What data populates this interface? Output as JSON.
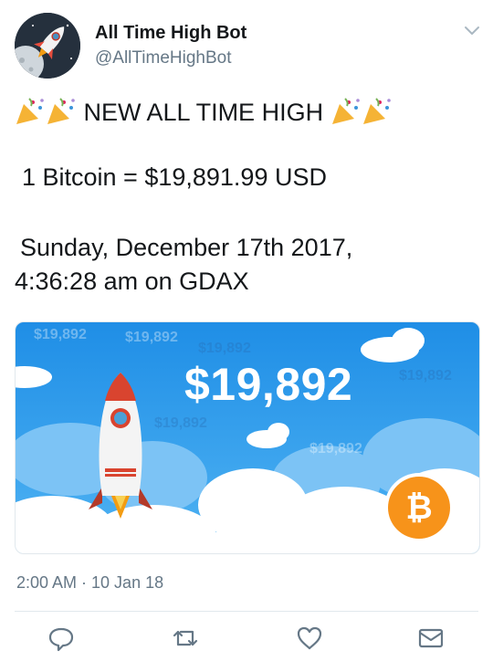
{
  "author": {
    "display_name": "All Time High Bot",
    "handle": "@AllTimeHighBot",
    "avatar_icon": "rocket-moon-icon"
  },
  "tweet": {
    "headline": "NEW ALL TIME HIGH",
    "price_line": "1 Bitcoin = $19,891.99 USD",
    "date_line": "Sunday, December 17th 2017,",
    "time_line": "4:36:28 am on GDAX"
  },
  "card": {
    "big_price": "$19,892",
    "ghost_price": "$19,892",
    "coin_symbol": "₿"
  },
  "meta": {
    "timestamp": "2:00 AM · 10 Jan 18"
  },
  "actions": [
    "reply-icon",
    "retweet-icon",
    "like-icon",
    "direct-message-icon"
  ],
  "colors": {
    "text": "#14171a",
    "secondary": "#657786",
    "card_sky": "#1f8ee6",
    "bitcoin": "#f7931a"
  }
}
